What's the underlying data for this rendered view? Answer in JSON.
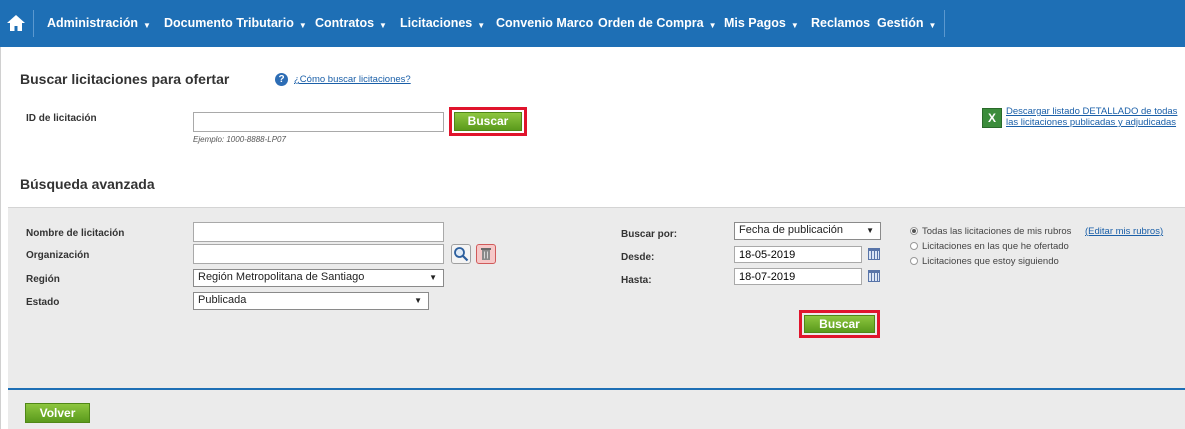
{
  "nav": {
    "items": [
      {
        "label": "Administración",
        "has_dropdown": true
      },
      {
        "label": "Documento Tributario",
        "has_dropdown": true
      },
      {
        "label": "Contratos",
        "has_dropdown": true
      },
      {
        "label": "Licitaciones",
        "has_dropdown": true
      },
      {
        "label": "Convenio Marco",
        "has_dropdown": false
      },
      {
        "label": "Orden de Compra",
        "has_dropdown": true
      },
      {
        "label": "Mis Pagos",
        "has_dropdown": true
      },
      {
        "label": "Reclamos",
        "has_dropdown": false
      },
      {
        "label": "Gestión",
        "has_dropdown": true
      }
    ],
    "home_icon": "home-icon",
    "caret_icon": "chevron-down-icon",
    "color": "#1e6fb5"
  },
  "search": {
    "title": "Buscar licitaciones para ofertar",
    "help_link": "¿Cómo buscar licitaciones?",
    "id_label": "ID de licitación",
    "id_value": "",
    "id_example": "Ejemplo: 1000-8888-LP07",
    "button": "Buscar"
  },
  "download": {
    "icon": "excel-icon",
    "link": "Descargar listado DETALLADO de todas las licitaciones publicadas y adjudicadas"
  },
  "advanced": {
    "title": "Búsqueda avanzada",
    "nombre_label": "Nombre de licitación",
    "nombre_value": "",
    "organizacion_label": "Organización",
    "organizacion_value": "",
    "region_label": "Región",
    "region_value": "Región Metropolitana de Santiago",
    "estado_label": "Estado",
    "estado_value": "Publicada",
    "buscar_por_label": "Buscar por:",
    "buscar_por_value": "Fecha de publicación",
    "desde_label": "Desde:",
    "desde_value": "18-05-2019",
    "hasta_label": "Hasta:",
    "hasta_value": "18-07-2019",
    "radios": [
      {
        "label": "Todas las licitaciones de mis rubros",
        "checked": true
      },
      {
        "label": "Licitaciones en las que he ofertado",
        "checked": false
      },
      {
        "label": "Licitaciones que estoy siguiendo",
        "checked": false
      }
    ],
    "edit_rubros": "(Editar mis rubros)",
    "button": "Buscar"
  },
  "footer": {
    "back_button": "Volver"
  },
  "colors": {
    "highlight": "#e0142c",
    "button_green": "#6aaa24",
    "link": "#1a5fa8"
  }
}
